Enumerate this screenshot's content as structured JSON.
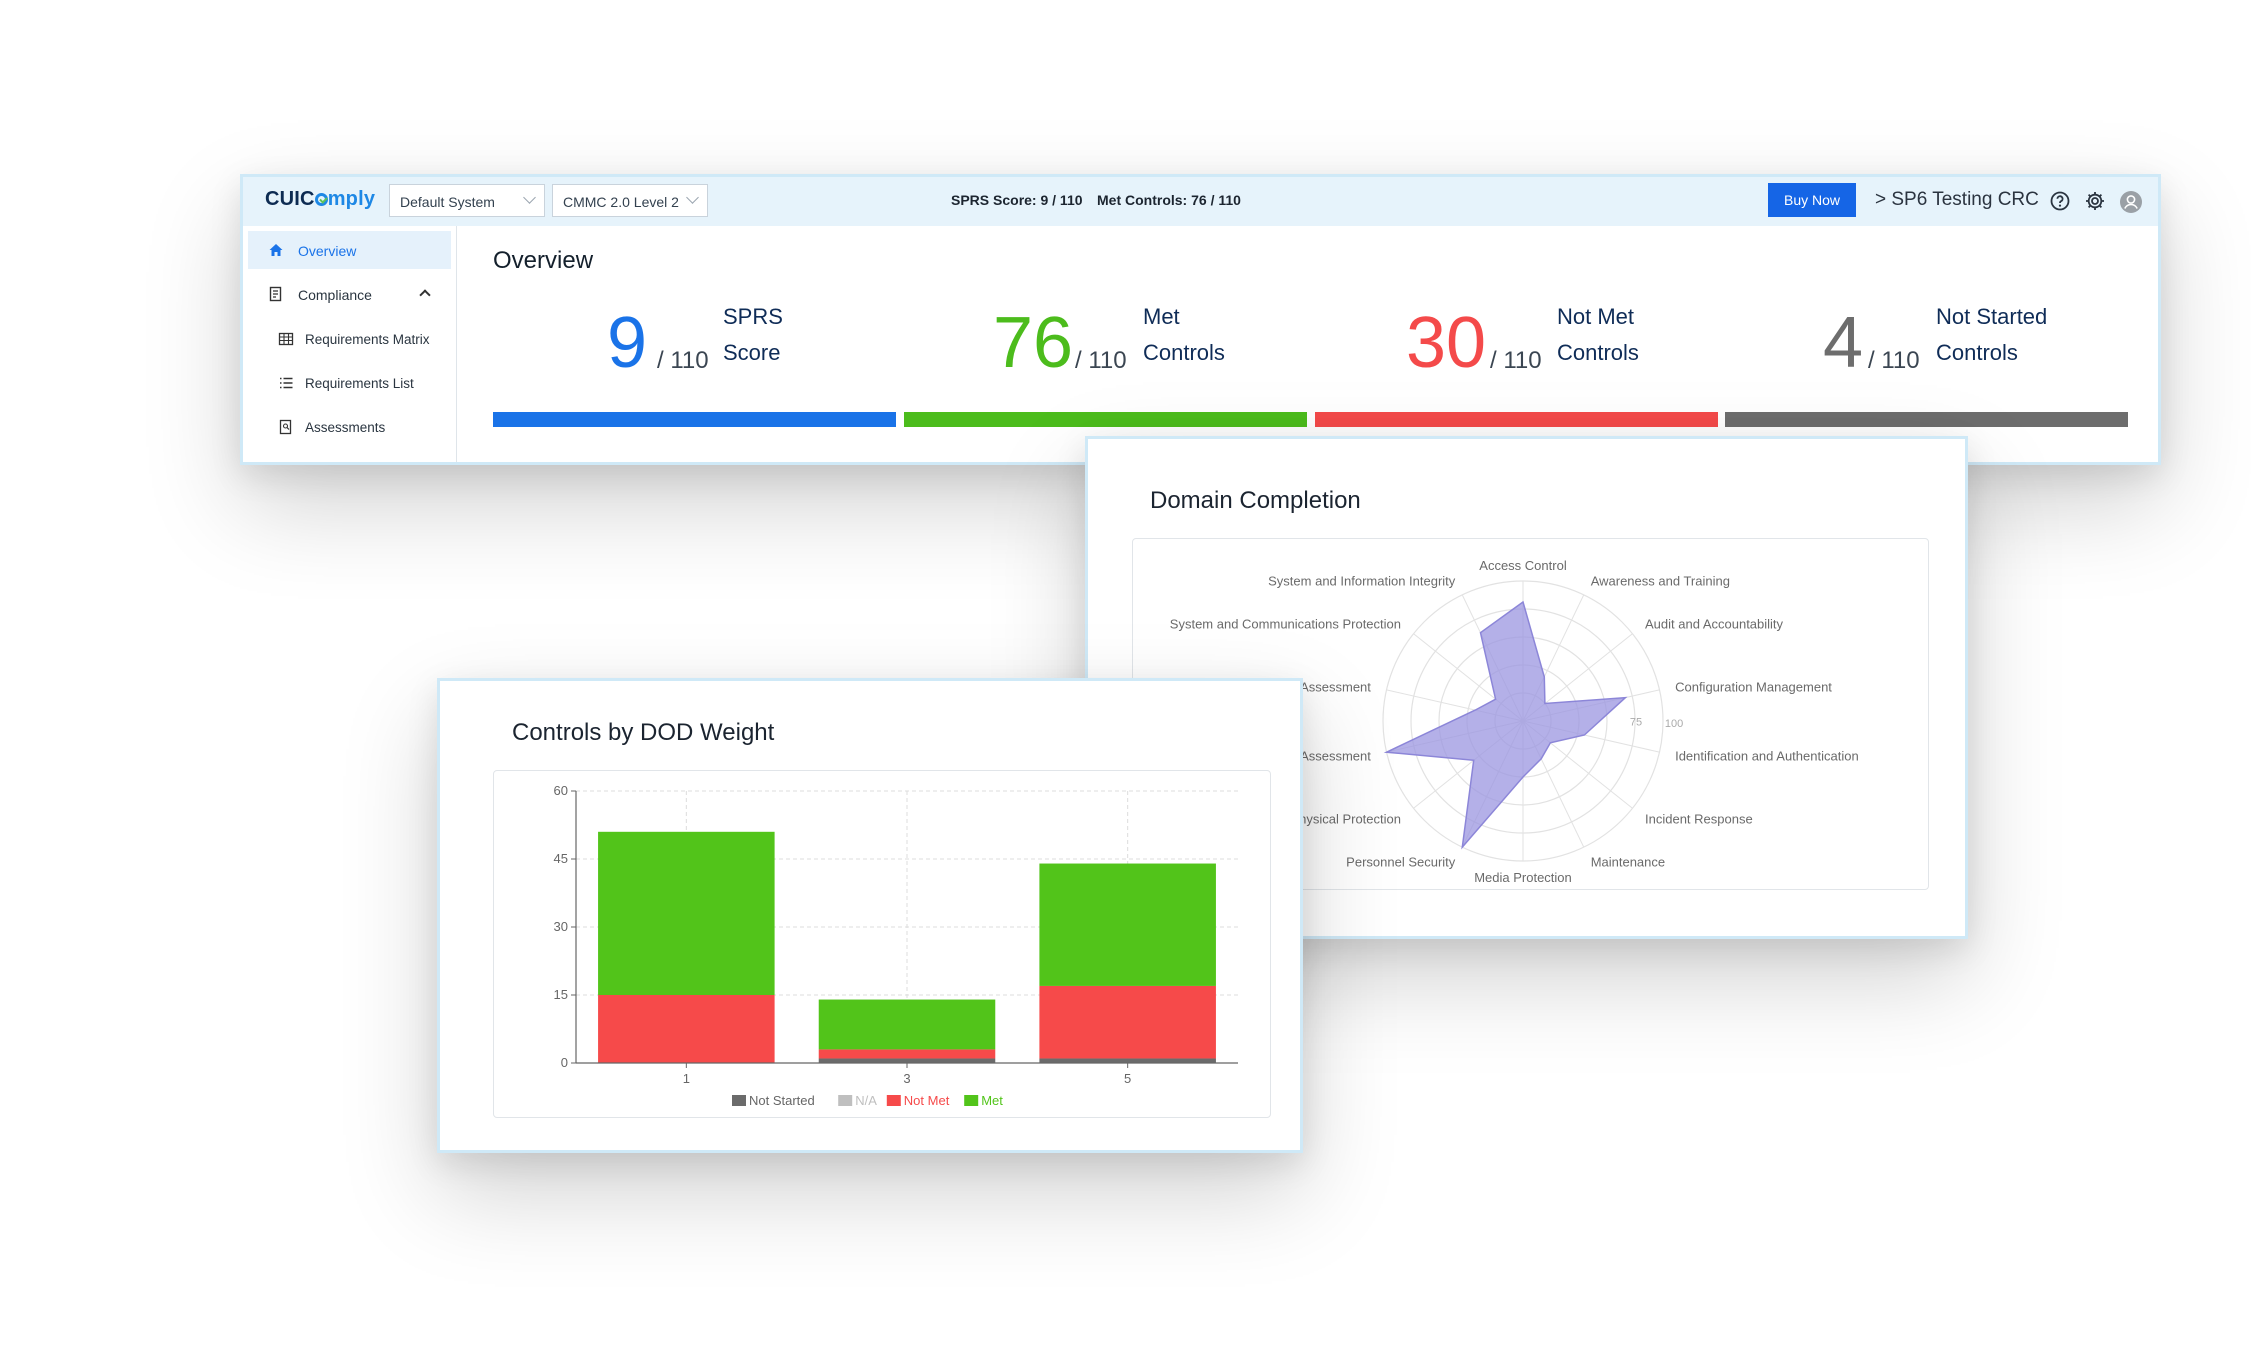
{
  "header": {
    "logo_a": "CUIC",
    "logo_b": "mply",
    "system_select": "Default System",
    "framework_select": "CMMC 2.0 Level 2",
    "sprs_stat": "SPRS Score: 9 / 110",
    "met_stat": "Met Controls: 76 / 110",
    "buy_label": "Buy Now",
    "org_breadcrumb": "> SP6 Testing CRC"
  },
  "sidebar": {
    "items": [
      {
        "label": "Overview",
        "icon": "home-icon"
      },
      {
        "label": "Compliance",
        "icon": "clipboard-icon"
      },
      {
        "label": "Requirements Matrix",
        "icon": "table-icon"
      },
      {
        "label": "Requirements List",
        "icon": "list-icon"
      },
      {
        "label": "Assessments",
        "icon": "assessment-icon"
      }
    ]
  },
  "overview": {
    "title": "Overview",
    "metrics": [
      {
        "value": "9",
        "denom": "/ 110",
        "line1": "SPRS",
        "line2": "Score",
        "color": "#1a73e8"
      },
      {
        "value": "76",
        "denom": "/ 110",
        "line1": "Met",
        "line2": "Controls",
        "color": "#4cbc1c"
      },
      {
        "value": "30",
        "denom": "/ 110",
        "line1": "Not Met",
        "line2": "Controls",
        "color": "#f44a4a"
      },
      {
        "value": "4",
        "denom": "/ 110",
        "line1": "Not Started",
        "line2": "Controls",
        "color": "#6d6d6d"
      }
    ]
  },
  "domain_completion": {
    "title": "Domain Completion",
    "tick_labels": [
      "75",
      "100"
    ]
  },
  "dod_weight": {
    "title": "Controls by DOD Weight"
  },
  "chart_data": [
    {
      "type": "radar",
      "title": "Domain Completion",
      "categories": [
        "Access Control",
        "Awareness and Training",
        "Audit and Accountability",
        "Configuration Management",
        "Identification and Authentication",
        "Incident Response",
        "Maintenance",
        "Media Protection",
        "Personnel Security",
        "Physical Protection",
        "Assessment",
        "Security Assessment",
        "System and Communications Protection",
        "System and Information Integrity"
      ],
      "series": [
        {
          "values": [
            85,
            35,
            20,
            75,
            45,
            25,
            30,
            40,
            100,
            45,
            100,
            35,
            25,
            70
          ]
        }
      ],
      "rmax": 100,
      "color": "#9b96e0"
    },
    {
      "type": "bar",
      "stacked": true,
      "title": "Controls by DOD Weight",
      "categories": [
        "1",
        "3",
        "5"
      ],
      "series": [
        {
          "name": "Not Started",
          "values": [
            0,
            1,
            1
          ],
          "color": "#6b6b6b"
        },
        {
          "name": "N/A",
          "values": [
            0,
            0,
            0
          ],
          "color": "#bfbfbf"
        },
        {
          "name": "Not Met",
          "values": [
            15,
            2,
            16
          ],
          "color": "#f64a4a"
        },
        {
          "name": "Met",
          "values": [
            36,
            11,
            27
          ],
          "color": "#52c41a"
        }
      ],
      "ylim": [
        0,
        60
      ],
      "yticks": [
        0,
        15,
        30,
        45,
        60
      ],
      "grid": true,
      "legend": "bottom"
    }
  ]
}
